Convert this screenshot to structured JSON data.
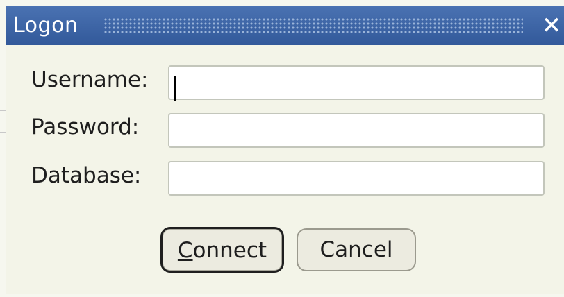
{
  "window": {
    "title": "Logon",
    "close_icon": "close-icon"
  },
  "form": {
    "username_label": "Username:",
    "username_value": "",
    "password_label": "Password:",
    "password_value": "",
    "database_label": "Database:",
    "database_value": ""
  },
  "buttons": {
    "connect_mnemonic": "C",
    "connect_rest": "onnect",
    "cancel_label": "Cancel"
  },
  "colors": {
    "titlebar": "#3c64a4",
    "dialog_bg": "#f3f4e8",
    "field_bg": "#ffffff"
  }
}
